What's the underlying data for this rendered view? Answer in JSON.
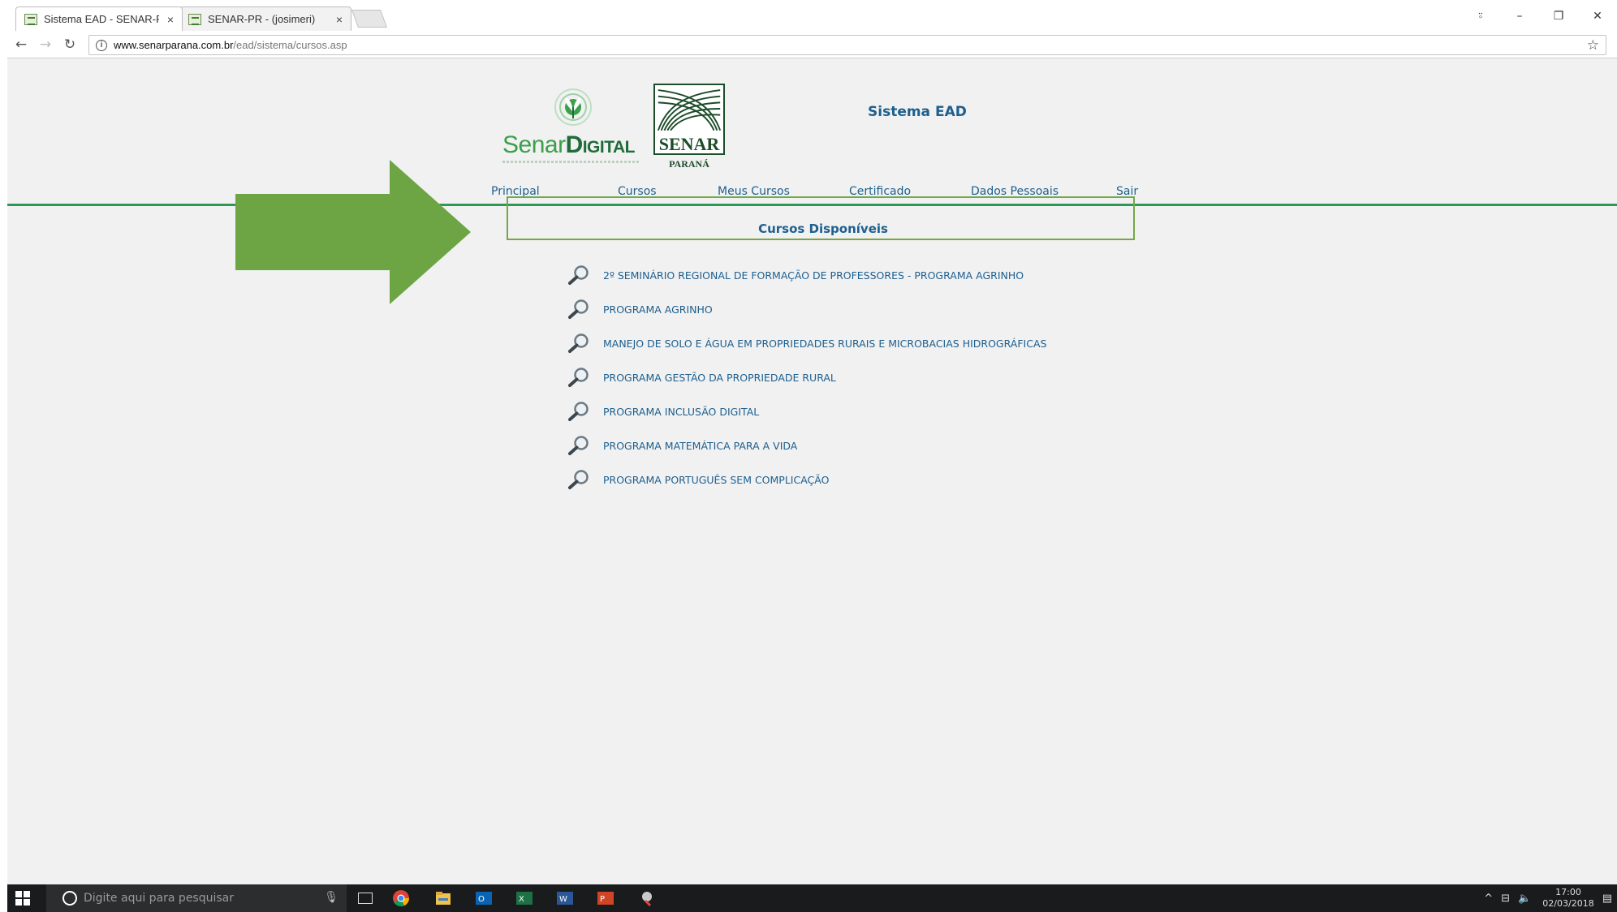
{
  "browser": {
    "tabs": [
      {
        "title": "Sistema EAD - SENAR-PR",
        "active": true
      },
      {
        "title": "SENAR-PR - (josimeri)",
        "active": false
      }
    ],
    "close_glyph": "×",
    "url_host": "www.senarparana.com.br",
    "url_path": "/ead/sistema/cursos.asp",
    "window_controls": {
      "account": "⍤",
      "minimize": "–",
      "restore": "❐",
      "close": "✕"
    }
  },
  "header": {
    "logo_left": {
      "word1": "Senar",
      "word2": "Digital"
    },
    "logo_right": {
      "name": "SENAR",
      "region": "PARANÁ"
    },
    "system_title": "Sistema EAD"
  },
  "nav": {
    "items": [
      "Principal",
      "Cursos",
      "Meus Cursos",
      "Certificado",
      "Dados Pessoais",
      "Sair"
    ]
  },
  "courses": {
    "title": "Cursos Disponíveis",
    "items": [
      "2º SEMINÁRIO REGIONAL DE FORMAÇÃO DE PROFESSORES - PROGRAMA AGRINHO",
      "PROGRAMA AGRINHO",
      "MANEJO DE SOLO E ÁGUA EM PROPRIEDADES RURAIS E MICROBACIAS HIDROGRÁFICAS",
      "PROGRAMA GESTÃO DA PROPRIEDADE RURAL",
      "PROGRAMA INCLUSÃO DIGITAL",
      "PROGRAMA MATEMÁTICA PARA A VIDA",
      "PROGRAMA PORTUGUÊS SEM COMPLICAÇÃO"
    ],
    "highlighted_index": 0
  },
  "annotation": {
    "arrow_color": "#6ea544",
    "box_color": "#74a846"
  },
  "taskbar": {
    "search_placeholder": "Digite aqui para pesquisar",
    "apps": [
      "chrome-icon",
      "file-explorer-icon",
      "outlook-icon",
      "excel-icon",
      "word-icon",
      "powerpoint-icon",
      "misc-app-icon"
    ],
    "time": "17:00",
    "date": "02/03/2018"
  },
  "colors": {
    "link_blue": "#1d5f8f",
    "nav_rule_green": "#2c9a55",
    "page_bg": "#f1f1f1"
  }
}
